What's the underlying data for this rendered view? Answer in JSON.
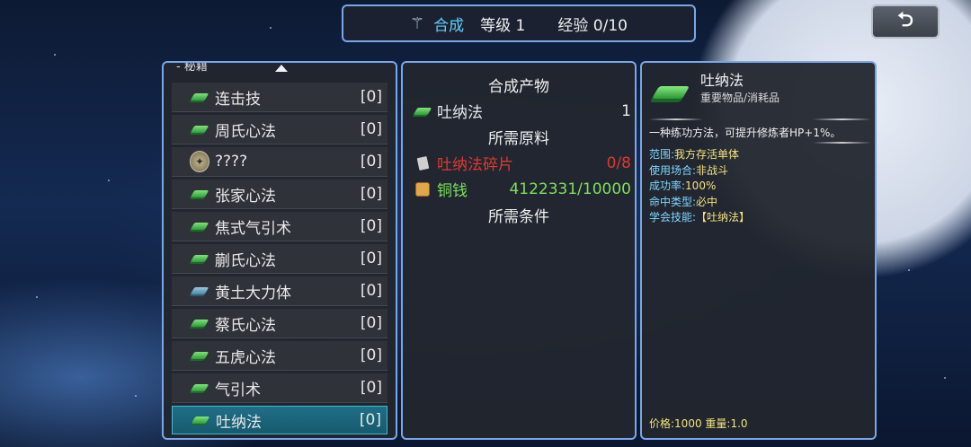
{
  "header": {
    "title": "合成",
    "level_label": "等级 1",
    "exp_label": "经验 0/10",
    "wand_icon": "wand-icon"
  },
  "back_button": {
    "icon": "return-arrow-icon",
    "glyph": "⮌"
  },
  "left_panel": {
    "category": "- 秘籍",
    "items": [
      {
        "name": "连击技",
        "count": "[0]",
        "icon": "green-book-icon"
      },
      {
        "name": "周氏心法",
        "count": "[0]",
        "icon": "green-book-icon"
      },
      {
        "name": "????",
        "count": "[0]",
        "icon": "coin-icon"
      },
      {
        "name": "张家心法",
        "count": "[0]",
        "icon": "green-book-icon"
      },
      {
        "name": "焦式气引术",
        "count": "[0]",
        "icon": "green-book-icon"
      },
      {
        "name": "蒯氏心法",
        "count": "[0]",
        "icon": "green-book-icon"
      },
      {
        "name": "黄土大力体",
        "count": "[0]",
        "icon": "blue-book-icon"
      },
      {
        "name": "蔡氏心法",
        "count": "[0]",
        "icon": "green-book-icon"
      },
      {
        "name": "五虎心法",
        "count": "[0]",
        "icon": "green-book-icon"
      },
      {
        "name": "气引术",
        "count": "[0]",
        "icon": "green-book-icon"
      },
      {
        "name": "吐纳法",
        "count": "[0]",
        "icon": "green-book-icon",
        "selected": true
      }
    ]
  },
  "middle_panel": {
    "product_heading": "合成产物",
    "product": {
      "name": "吐纳法",
      "qty": "1"
    },
    "materials_heading": "所需原料",
    "materials": [
      {
        "name": "吐纳法碎片",
        "qty": "0/8",
        "color": "#e0392f"
      },
      {
        "name": "铜钱",
        "qty": "4122331/10000",
        "color": "#7ee05a"
      }
    ],
    "conditions_heading": "所需条件"
  },
  "right_panel": {
    "title": "吐纳法",
    "type": "重要物品/消耗品",
    "description": "一种练功方法，可提升修炼者HP+1%。",
    "props": [
      {
        "k": "范围:",
        "v": "我方存活单体"
      },
      {
        "k": "使用场合:",
        "v": "非战斗"
      },
      {
        "k": "成功率:",
        "v": "100%"
      },
      {
        "k": "命中类型:",
        "v": "必中"
      },
      {
        "k": "学会技能:",
        "v": "【吐纳法】"
      }
    ],
    "price": "价格:1000 重量:1.0"
  }
}
